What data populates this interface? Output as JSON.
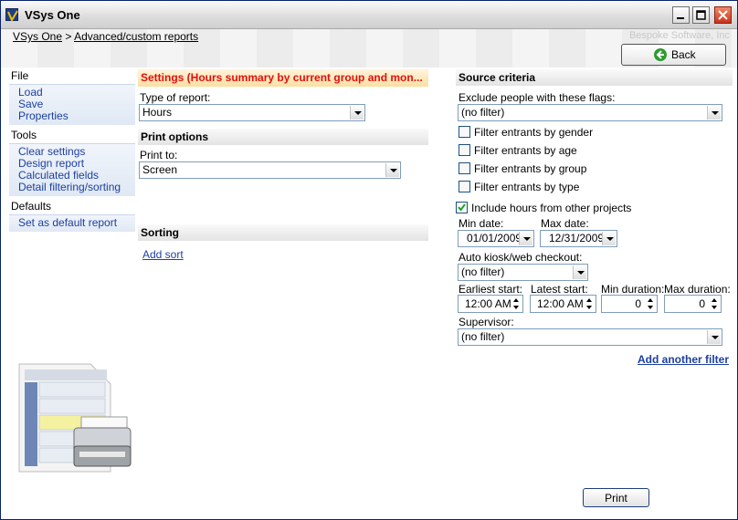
{
  "window": {
    "title": "VSys One"
  },
  "breadcrumb": {
    "root": "VSys One",
    "separator": ">",
    "current": "Advanced/custom reports"
  },
  "vendor": "Bespoke Software, Inc",
  "back_label": "Back",
  "nav": {
    "file": {
      "heading": "File",
      "items": [
        "Load",
        "Save",
        "Properties"
      ]
    },
    "tools": {
      "heading": "Tools",
      "items": [
        "Clear settings",
        "Design report",
        "Calculated fields",
        "Detail filtering/sorting"
      ]
    },
    "defaults": {
      "heading": "Defaults",
      "items": [
        "Set as default report"
      ]
    }
  },
  "settings": {
    "heading": "Settings (Hours summary by current group and mon...",
    "type_label": "Type of report:",
    "type_value": "Hours",
    "print_options_heading": "Print options",
    "print_to_label": "Print to:",
    "print_to_value": "Screen",
    "sorting_heading": "Sorting",
    "add_sort": "Add sort"
  },
  "criteria": {
    "heading": "Source criteria",
    "exclude_label": "Exclude people with these flags:",
    "exclude_value": "(no filter)",
    "checkboxes": [
      {
        "label": "Filter entrants by gender",
        "checked": false
      },
      {
        "label": "Filter entrants by age",
        "checked": false
      },
      {
        "label": "Filter entrants by group",
        "checked": false
      },
      {
        "label": "Filter entrants by type",
        "checked": false
      }
    ],
    "include_hours": {
      "label": "Include hours from other projects",
      "checked": true
    },
    "min_date_label": "Min date:",
    "min_date": "01/01/2009",
    "max_date_label": "Max date:",
    "max_date": "12/31/2009",
    "kiosk_label": "Auto kiosk/web checkout:",
    "kiosk_value": "(no filter)",
    "earliest_label": "Earliest start:",
    "earliest_value": "12:00 AM",
    "latest_label": "Latest start:",
    "latest_value": "12:00 AM",
    "min_dur_label": "Min duration:",
    "min_dur_value": "0",
    "max_dur_label": "Max duration:",
    "max_dur_value": "0",
    "supervisor_label": "Supervisor:",
    "supervisor_value": "(no filter)",
    "add_filter": "Add another filter"
  },
  "print_label": "Print"
}
